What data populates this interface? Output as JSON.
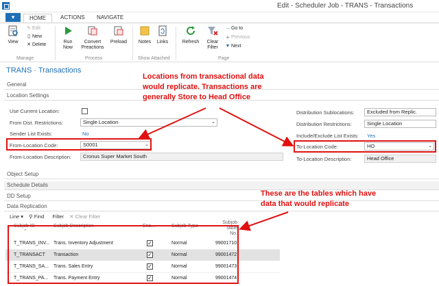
{
  "window": {
    "title": "Edit - Scheduler Job - TRANS - Transactions"
  },
  "tabs": {
    "home": "HOME",
    "actions": "ACTIONS",
    "navigate": "NAVIGATE"
  },
  "ribbon": {
    "view": "View",
    "edit": "Edit",
    "new": "New",
    "delete": "Delete",
    "manage_group": "Manage",
    "run_now_1": "Run",
    "run_now_2": "Now",
    "convert_1": "Convert",
    "convert_2": "Preactions",
    "preload": "Preload",
    "process_group": "Process",
    "notes": "Notes",
    "links": "Links",
    "attached_group": "Show Attached",
    "refresh": "Refresh",
    "clear_filter_1": "Clear",
    "clear_filter_2": "Filter",
    "goto": "Go to",
    "previous": "Previous",
    "next": "Next",
    "page_group": "Page"
  },
  "page": {
    "title": "TRANS · Transactions"
  },
  "sections": {
    "general": "General",
    "location_settings": "Location Settings",
    "object_setup": "Object Setup",
    "schedule_details": "Schedule Details",
    "dd_setup": "DD Setup",
    "data_replication": "Data Replication"
  },
  "left_fields": {
    "use_current_location_label": "Use Current Location:",
    "from_dist_restrictions_label": "From Dist. Restrictions:",
    "from_dist_restrictions_value": "Single Location",
    "sender_list_exists_label": "Sender List Exists:",
    "sender_list_exists_value": "No",
    "from_location_code_label": "From-Location Code:",
    "from_location_code_value": "S0001",
    "from_location_desc_label": "From-Location Description:",
    "from_location_desc_value": "Cronus Super Market South"
  },
  "right_fields": {
    "dist_sublocations_label": "Distribution Sublocations:",
    "dist_sublocations_value": "Excluded from Replic.",
    "dist_restrictions_label": "Distribution Restrictions:",
    "dist_restrictions_value": "Single Location",
    "incl_excl_label": "Include/Exclude List Exists:",
    "incl_excl_value": "Yes",
    "to_location_code_label": "To-Location Code:",
    "to_location_code_value": "HO",
    "to_location_desc_label": "To-Location Description:",
    "to_location_desc_value": "Head Office"
  },
  "annotations": {
    "locations_1": "Locations from transactional data",
    "locations_2": "would replicate. Transactions are",
    "locations_3": "generally Store to Head Office",
    "tables_1": "These are the tables which have",
    "tables_2": "data that would replicate"
  },
  "list_toolbar": {
    "line": "Line",
    "find": "Find",
    "filter": "Filter",
    "clear_filter": "Clear Filter"
  },
  "table": {
    "headers": {
      "subjob_id": "Subjob ID",
      "subjob_desc": "Subjob Description",
      "enabled": "Ena...",
      "subjob_type": "Subjob Type",
      "subjob_table_1": "Subjob Table",
      "subjob_table_2": "No."
    },
    "rows": [
      {
        "id": "T_TRANS_INV...",
        "desc": "Trans. Inventory Adjustment",
        "enabled": "✓",
        "type": "Normal",
        "table": "99001710"
      },
      {
        "id": "T_TRANSACT",
        "desc": "Transaction",
        "enabled": "✓",
        "type": "Normal",
        "table": "99001472"
      },
      {
        "id": "T_TRANS_SA...",
        "desc": "Trans. Sales Entry",
        "enabled": "✓",
        "type": "Normal",
        "table": "99001473"
      },
      {
        "id": "T_TRANS_PA...",
        "desc": "Trans. Payment Entry",
        "enabled": "✓",
        "type": "Normal",
        "table": "99001474"
      }
    ]
  }
}
